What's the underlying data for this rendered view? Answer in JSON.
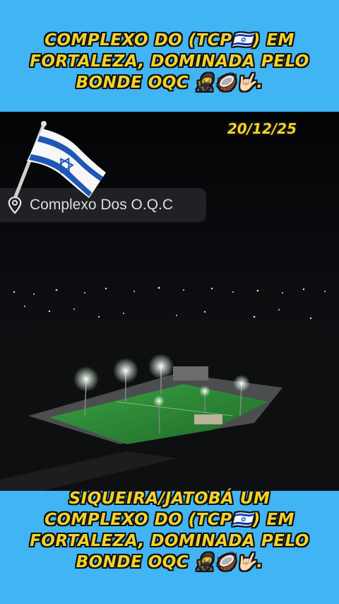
{
  "top_caption": {
    "line1": "COMPLEXO DO (TCP🇮🇱) EM",
    "line2": "FORTALEZA, DOMINADA PELO",
    "line3": "BONDE OQC 🥷🥥🤟🏻."
  },
  "date": "20/12/25",
  "location": {
    "label": "Complexo Dos O.Q.C",
    "icon": "map-pin-icon"
  },
  "flag_icon": "israel-flag-icon",
  "bottom_caption": {
    "line1": "SIQUEIRA/JATOBÁ UM",
    "line2": "COMPLEXO DO (TCP🇮🇱) EM",
    "line3": "FORTALEZA, DOMINADA PELO",
    "line4": "BONDE OQC 🥷🥥🤟🏻."
  },
  "colors": {
    "background": "#41b4f4",
    "caption_text": "#f2d22a",
    "field_green": "#2f8a35"
  }
}
